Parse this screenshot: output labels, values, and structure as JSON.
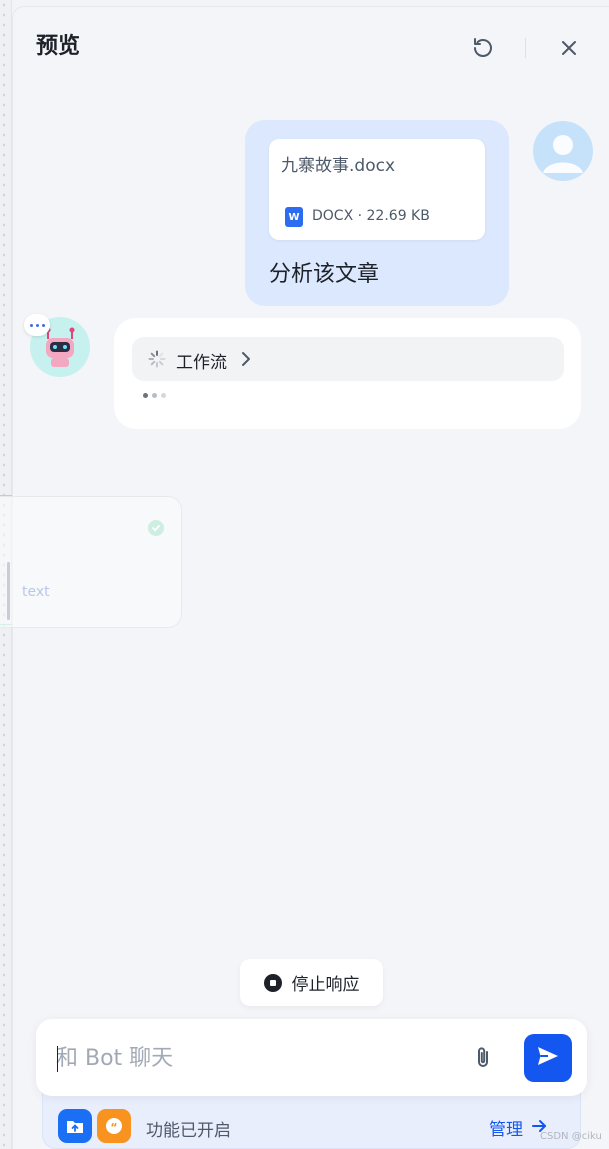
{
  "header": {
    "title": "预览"
  },
  "user_message": {
    "file": {
      "name": "九寨故事.docx",
      "meta": "DOCX · 22.69 KB",
      "icon": "word-doc-icon"
    },
    "text": "分析该文章"
  },
  "bot_message": {
    "workflow_label": "工作流"
  },
  "canvas": {
    "ghost_label": "text"
  },
  "actions": {
    "stop_label": "停止响应"
  },
  "composer": {
    "placeholder": "和 Bot 聊天",
    "value": ""
  },
  "features": {
    "status_label": "功能已开启",
    "manage_label": "管理"
  },
  "watermark": "CSDN @ciku",
  "colors": {
    "accent": "#1456f0",
    "user_bubble": "#dce8fd",
    "feature_upload": "#1b6ff5",
    "feature_quote": "#f7931e"
  }
}
